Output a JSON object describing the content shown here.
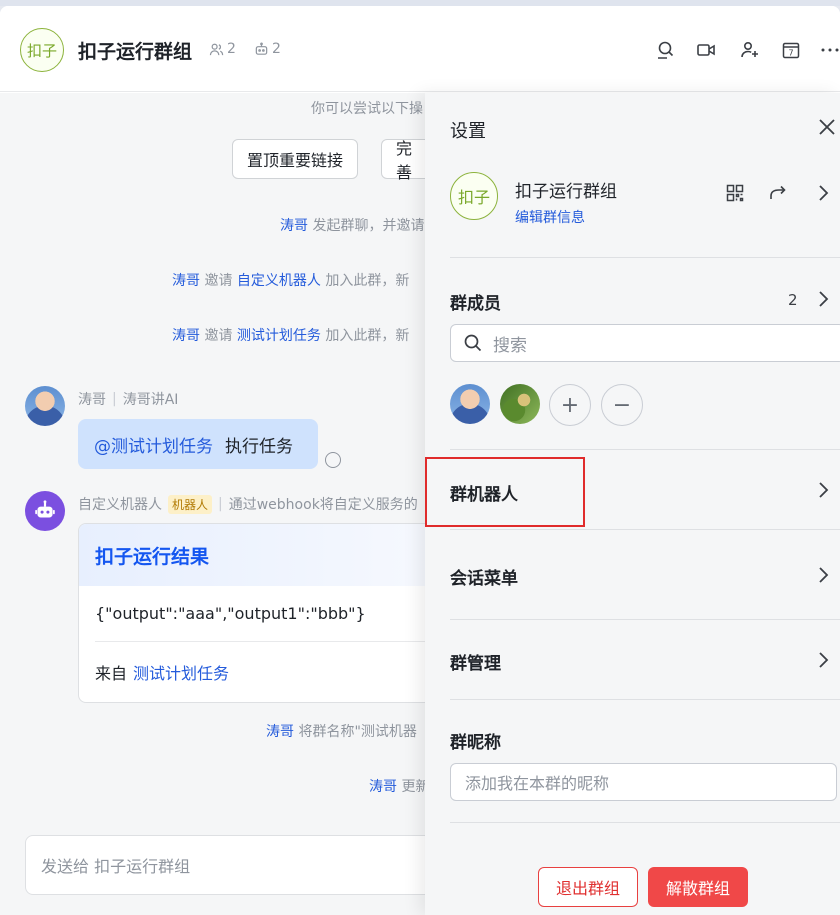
{
  "header": {
    "group_avatar_text": "扣子",
    "title": "扣子运行群组",
    "member_count": "2",
    "bot_count": "2",
    "icons": [
      "search-icon",
      "video-icon",
      "add-user-icon",
      "calendar-icon",
      "more-icon"
    ],
    "calendar_day": "7"
  },
  "chat": {
    "hint": "你可以尝试以下操",
    "pills": [
      "置顶重要链接",
      "完善"
    ],
    "system_messages": [
      {
        "actor": "涛哥",
        "text": "发起群聊，并邀请"
      },
      {
        "actor": "涛哥",
        "verb": "邀请",
        "target": "自定义机器人",
        "text": "加入此群，新"
      },
      {
        "actor": "涛哥",
        "verb": "邀请",
        "target": "测试计划任务",
        "text": "加入此群，新"
      }
    ],
    "message1": {
      "sender": "涛哥",
      "sender_title": "涛哥讲AI",
      "mention": "@测试计划任务",
      "text": "执行任务"
    },
    "message2": {
      "sender": "自定义机器人",
      "tag": "机器人",
      "description": "通过webhook将自定义服务的",
      "card_title": "扣子运行结果",
      "card_output": "{\"output\":\"aaa\",\"output1\":\"bbb\"}",
      "card_from_label": "来自",
      "card_from_link": "测试计划任务"
    },
    "system_after": [
      {
        "actor": "涛哥",
        "text": "将群名称\"测试机器"
      },
      {
        "actor": "涛哥",
        "text": "更新"
      }
    ],
    "compose_placeholder": "发送给 扣子运行群组"
  },
  "panel": {
    "title": "设置",
    "group_avatar_text": "扣子",
    "group_name": "扣子运行群组",
    "edit_link": "编辑群信息",
    "members_title": "群成员",
    "members_count": "2",
    "search_placeholder": "搜索",
    "add_symbol": "+",
    "remove_symbol": "−",
    "bots_title": "群机器人",
    "menu_title": "会话菜单",
    "manage_title": "群管理",
    "nickname_title": "群昵称",
    "nickname_placeholder": "添加我在本群的昵称",
    "quit_button": "退出群组",
    "dissolve_button": "解散群组"
  },
  "colors": {
    "accent": "#245bdb",
    "danger": "#f04848",
    "highlight_box": "#e02b2b",
    "bot_avatar": "#7b4fe0"
  }
}
